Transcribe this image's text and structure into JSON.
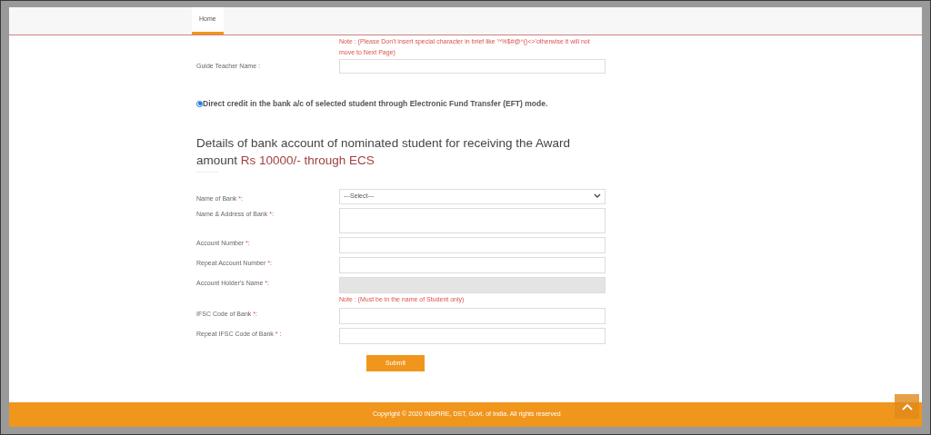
{
  "nav": {
    "tabs": [
      {
        "label": "Home",
        "selected": true
      }
    ]
  },
  "note_top": "Note : (Please Don't insert special character in brief like '^%$#@^()<>'otherwise it will not move to Next Page)",
  "guide_teacher": {
    "label": "Guide Teacher Name :"
  },
  "payment_option": {
    "label": "Direct credit in the bank a/c of selected student through Electronic Fund Transfer (EFT) mode.",
    "selected": true
  },
  "heading": {
    "text": "Details of bank account of nominated student for receiving the Award amount ",
    "highlight": "Rs 10000/- through ECS"
  },
  "fields": [
    {
      "kind": "select",
      "label": "Name of Bank ",
      "mark": "*",
      "tail": ":",
      "value": "---Select---"
    },
    {
      "kind": "textarea",
      "label": "Name & Address of Bank ",
      "mark": "*",
      "tail": ":"
    },
    {
      "kind": "input",
      "label": "Account Number ",
      "mark": "*",
      "tail": ":",
      "disabled": false
    },
    {
      "kind": "input",
      "label": "Repeat Account Number ",
      "mark": "*",
      "tail": ":",
      "disabled": false
    },
    {
      "kind": "input",
      "label": "Account Holder's Name ",
      "mark": "*",
      "tail": ":",
      "disabled": true,
      "note": "Note : (Must be in the name of Student only)"
    },
    {
      "kind": "input",
      "label": "IFSC Code of Bank ",
      "mark": "*",
      "tail": ":",
      "disabled": false
    },
    {
      "kind": "input",
      "label": "Repeat IFSC Code of Bank ",
      "mark": "*",
      "tail": " :",
      "disabled": false
    }
  ],
  "submit": "Submit",
  "footer": "Copyright © 2020 INSPIRE, DST, Govt. of India. All rights reserved"
}
